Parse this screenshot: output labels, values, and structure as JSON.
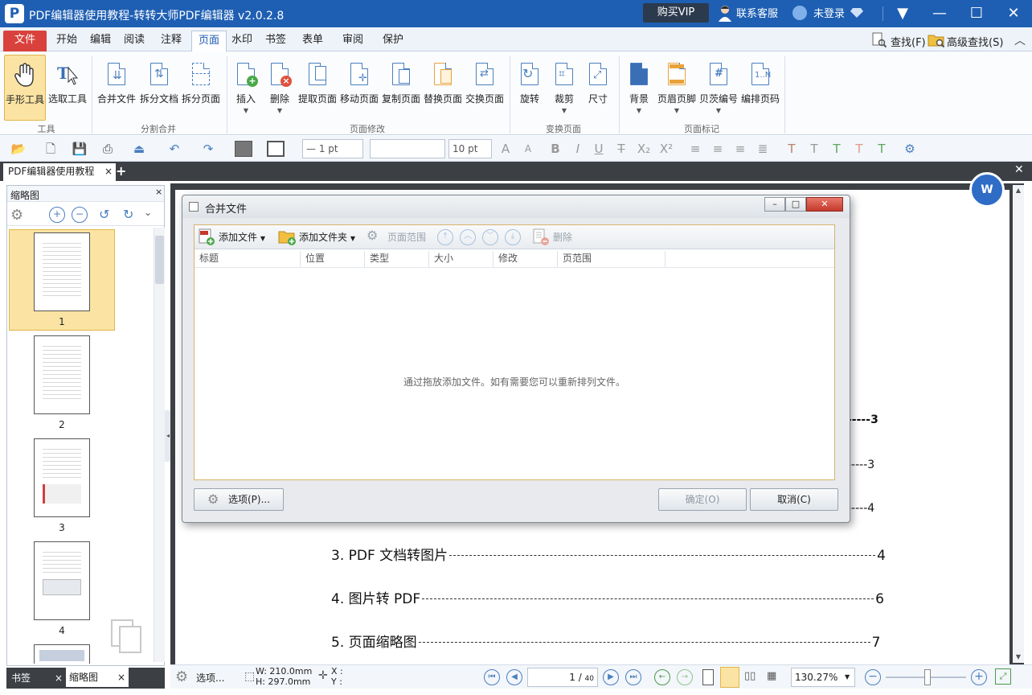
{
  "app": {
    "logo_letter": "P",
    "title": "PDF编辑器使用教程-转转大师PDF编辑器 v2.0.2.8",
    "buy_vip": "购买VIP",
    "support": "联系客服",
    "login": "未登录"
  },
  "menu": {
    "file": "文件",
    "tabs": [
      "开始",
      "编辑",
      "阅读",
      "注释",
      "页面",
      "水印",
      "书签",
      "表单",
      "审阅",
      "保护"
    ],
    "active_tab": "页面",
    "find": "查找(F)",
    "advanced_find": "高级查找(S)"
  },
  "ribbon": {
    "groups": {
      "tools": "工具",
      "split_merge": "分割合并",
      "page_modify": "页面修改",
      "transform": "变换页面",
      "page_mark": "页面标记"
    },
    "buttons": {
      "hand": "手形工具",
      "select": "选取工具",
      "merge": "合并文件",
      "split_doc": "拆分文档",
      "split_page": "拆分页面",
      "insert": "插入",
      "delete": "删除",
      "extract": "提取页面",
      "move": "移动页面",
      "copy": "复制页面",
      "replace": "替换页面",
      "swap": "交换页面",
      "rotate": "旋转",
      "crop": "裁剪",
      "size": "尺寸",
      "background": "背景",
      "header_footer": "页眉页脚",
      "bates": "贝茨编号",
      "page_number": "编排页码"
    }
  },
  "toolbar": {
    "line_width": "— 1 pt",
    "font_size": "10 pt"
  },
  "doc_tab": "PDF编辑器使用教程",
  "left_panel": {
    "title": "缩略图",
    "thumbs": [
      "1",
      "2",
      "3",
      "4"
    ],
    "bottom_tabs": [
      "书签",
      "缩略图"
    ]
  },
  "document": {
    "toc": [
      {
        "text": "3. PDF 文档转图片",
        "page": "4"
      },
      {
        "text": "4.  图片转 PDF",
        "page": "6"
      },
      {
        "text": "5.  页面缩略图",
        "page": "7"
      }
    ],
    "partial_page_numbers": [
      "3",
      "3",
      "4"
    ]
  },
  "dialog": {
    "title": "合并文件",
    "add_file": "添加文件",
    "add_folder": "添加文件夹",
    "page_range": "页面范围",
    "delete": "删除",
    "columns": [
      "标题",
      "位置",
      "类型",
      "大小",
      "修改",
      "页范围"
    ],
    "empty_hint": "通过拖放添加文件。如有需要您可以重新排列文件。",
    "options": "选项(P)...",
    "ok": "确定(O)",
    "cancel": "取消(C)"
  },
  "status": {
    "options": "选项...",
    "width": "W: 210.0mm",
    "height": "H: 297.0mm",
    "x": "X :",
    "y": "Y :",
    "page_current": "1",
    "page_total": "40",
    "zoom": "130.27%"
  },
  "colors": {
    "title_bar": "#1e5fb3",
    "file_tab": "#d9423c",
    "accent": "#4a7fc0",
    "dialog_border": "#d7b46a"
  }
}
